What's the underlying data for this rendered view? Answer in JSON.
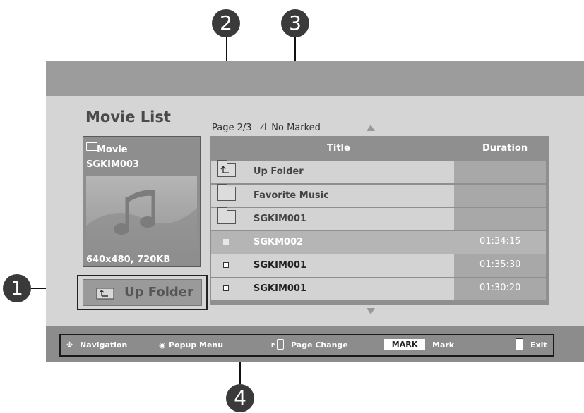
{
  "callouts": [
    "1",
    "2",
    "3",
    "4"
  ],
  "movie_list": {
    "title": "Movie List",
    "thumbnail": {
      "category": "Movie",
      "name": "SGKIM003",
      "info": "640x480, 720KB",
      "icon": "music-note-icon"
    },
    "up_folder_button": "Up Folder"
  },
  "page_info": {
    "page": "Page 2/3",
    "marked": "No Marked"
  },
  "list": {
    "header_title": "Title",
    "header_duration": "Duration",
    "rows": [
      {
        "name": "Up Folder",
        "duration": "",
        "type": "up-folder",
        "selected": false
      },
      {
        "name": "Favorite Music",
        "duration": "",
        "type": "folder",
        "selected": false
      },
      {
        "name": "SGKIM001",
        "duration": "",
        "type": "folder",
        "selected": false
      },
      {
        "name": "SGKM002",
        "duration": "01:34:15",
        "type": "file",
        "selected": true
      },
      {
        "name": "SGKIM001",
        "duration": "01:35:30",
        "type": "file",
        "selected": false
      },
      {
        "name": "SGKIM001",
        "duration": "01:30:20",
        "type": "file",
        "selected": false
      }
    ]
  },
  "footer": {
    "navigation": "Navigation",
    "popup_menu": "Popup Menu",
    "page_change": "Page Change",
    "page_key": "P",
    "mark_key": "MARK",
    "mark": "Mark",
    "exit": "Exit"
  },
  "colors": {
    "selected_row": "#b5b5b5",
    "row_bg": "#d3d3d3",
    "duration_cell": "#a8a8a8"
  }
}
